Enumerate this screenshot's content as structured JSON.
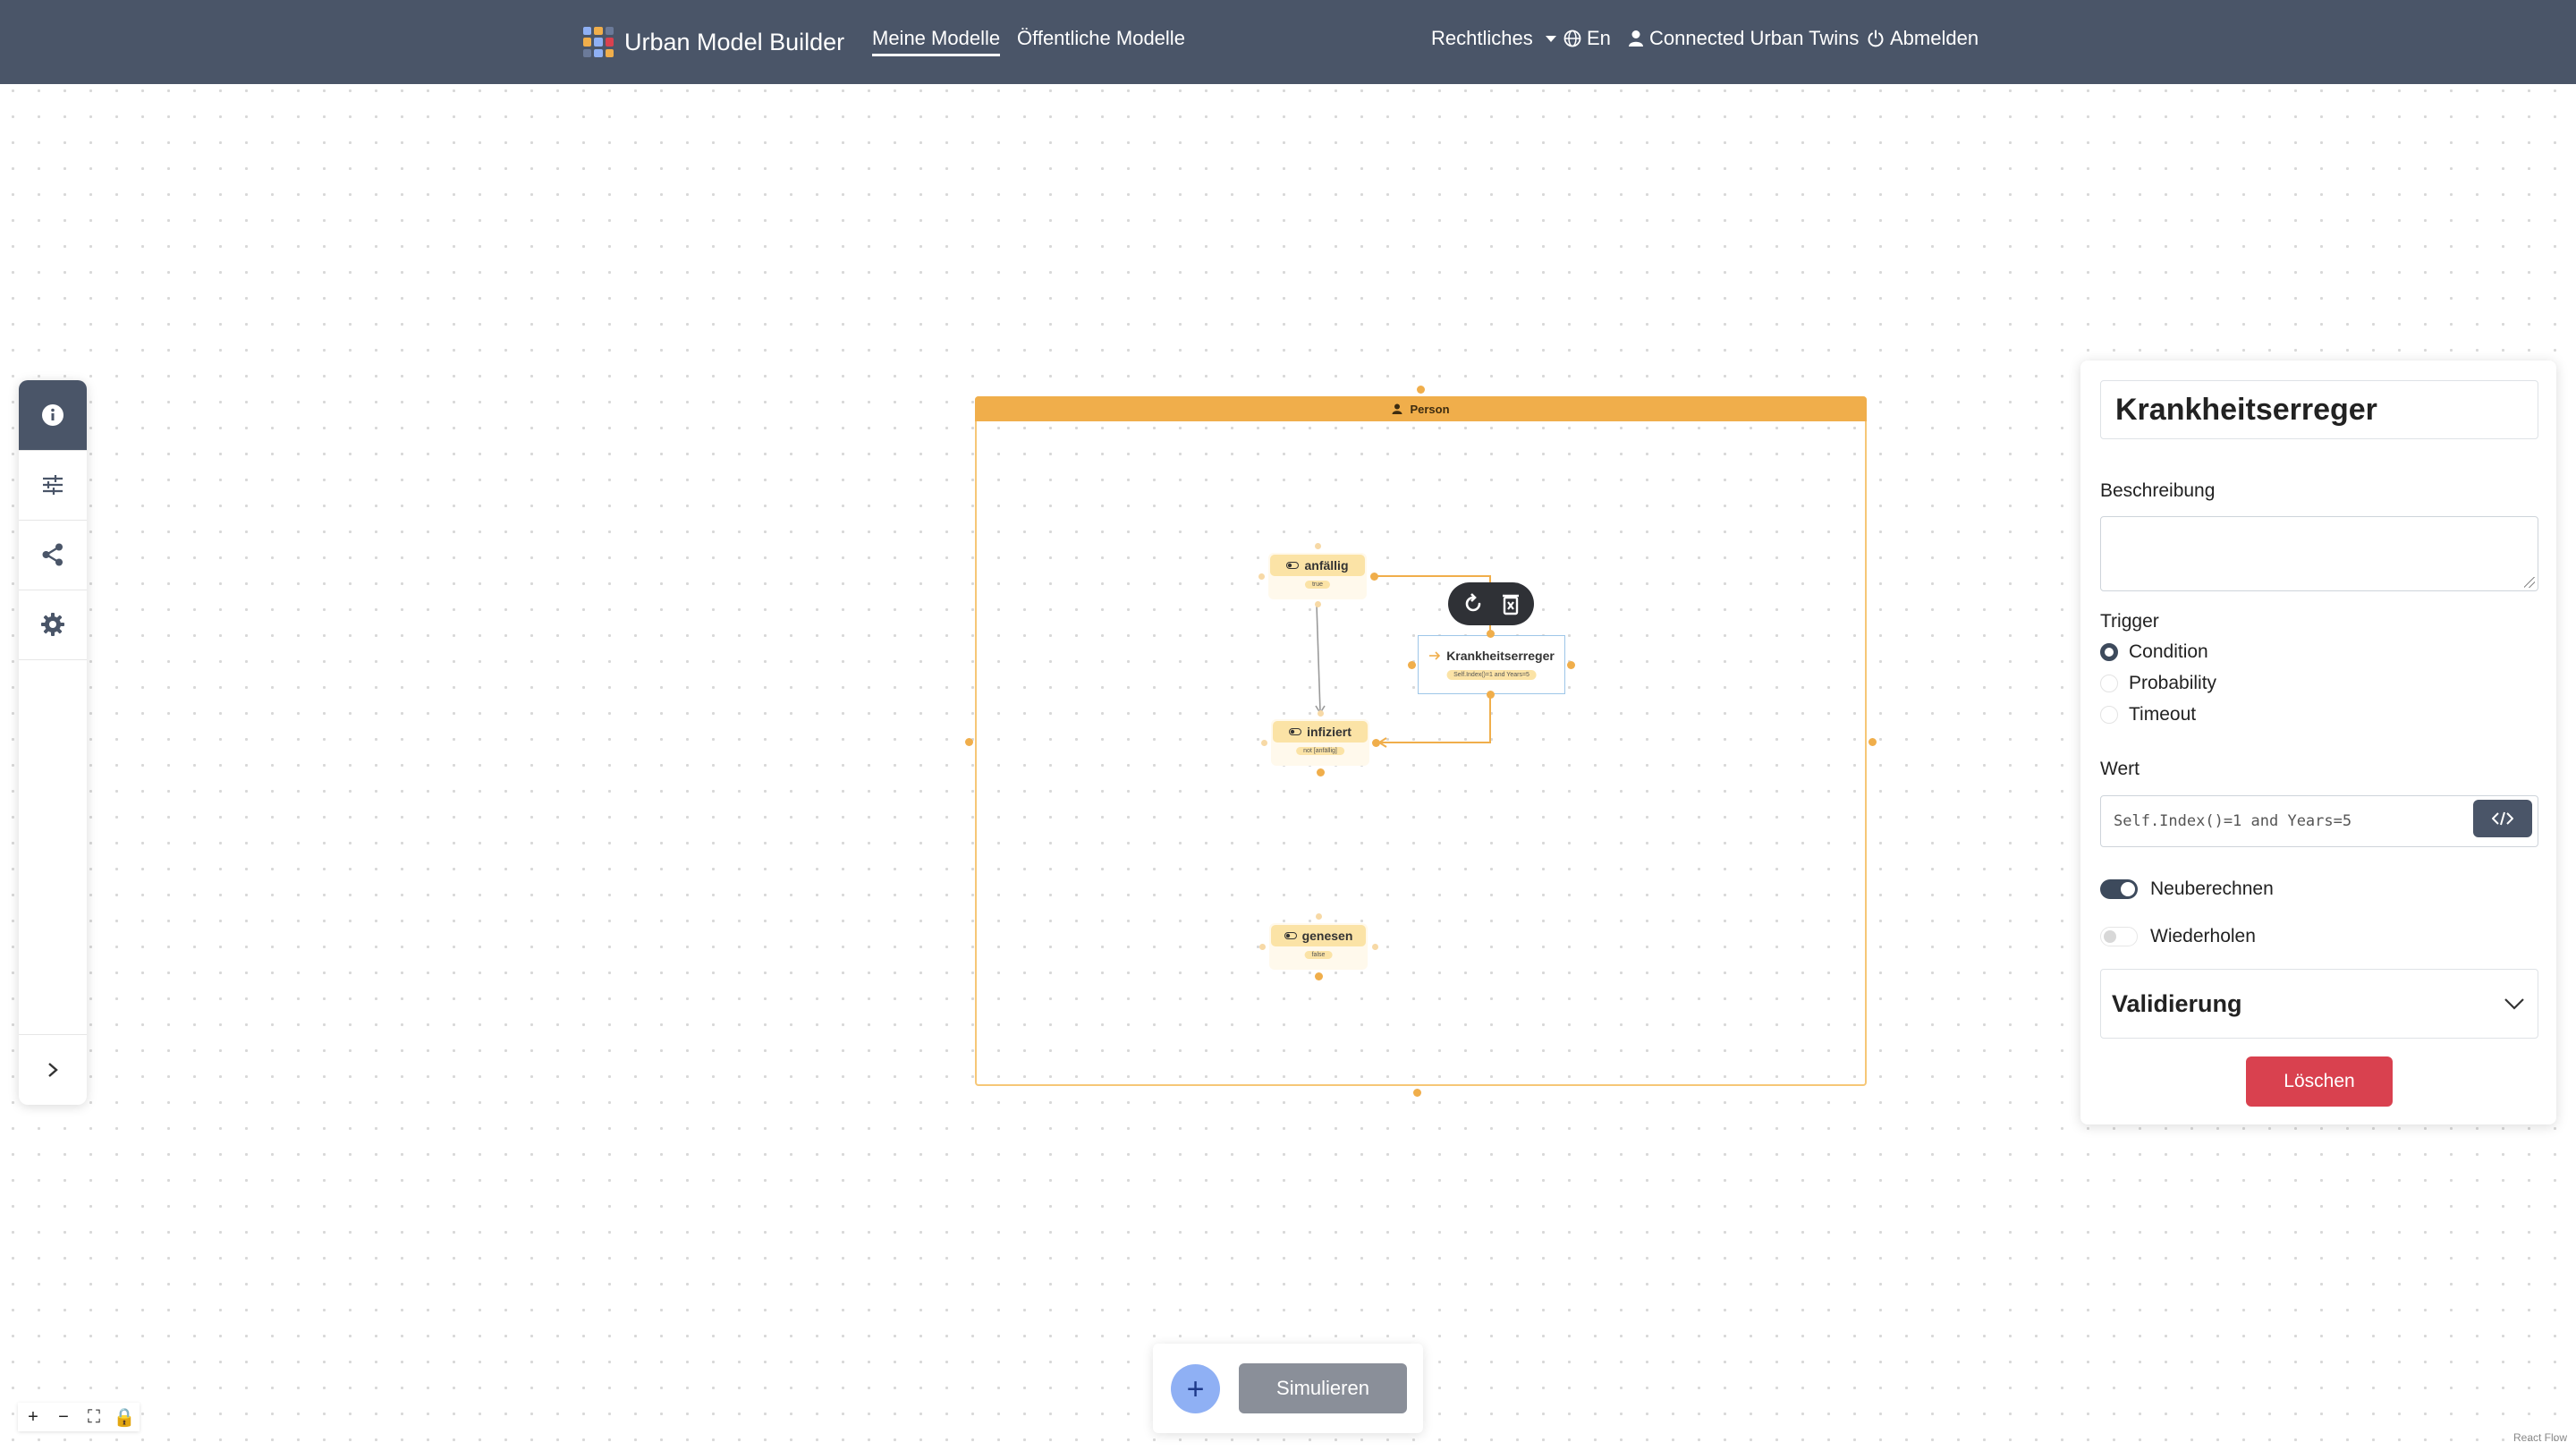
{
  "navbar": {
    "brand": "Urban Model Builder",
    "links": [
      "Meine Modelle",
      "Öffentliche Modelle"
    ],
    "legal": "Rechtliches",
    "language": "En",
    "user": "Connected Urban Twins",
    "logout": "Abmelden"
  },
  "sidebar": {
    "items": [
      {
        "icon": "info-icon",
        "active": true
      },
      {
        "icon": "sliders-icon",
        "active": false
      },
      {
        "icon": "share-icon",
        "active": false
      },
      {
        "icon": "gear-icon",
        "active": false
      }
    ],
    "expand_icon": "chevron-right-icon"
  },
  "canvas": {
    "group_label": "Person",
    "states": [
      {
        "name": "anfällig",
        "value": "true"
      },
      {
        "name": "infiziert",
        "value": "not [anfällig]"
      },
      {
        "name": "genesen",
        "value": "false"
      }
    ],
    "transition": {
      "name": "Krankheitserreger",
      "value": "Self.Index()=1 and Years=5"
    }
  },
  "panel": {
    "title": "Krankheitserreger",
    "description_label": "Beschreibung",
    "trigger_label": "Trigger",
    "trigger_options": [
      "Condition",
      "Probability",
      "Timeout"
    ],
    "trigger_selected": "Condition",
    "value_label": "Wert",
    "value_code": "Self.Index()=1 and Years=5",
    "recalculate_label": "Neuberechnen",
    "recalculate_on": true,
    "repeat_label": "Wiederholen",
    "repeat_on": false,
    "validation_label": "Validierung",
    "delete_label": "Löschen"
  },
  "actions": {
    "add": "+",
    "simulate": "Simulieren"
  },
  "flow_controls": [
    "+",
    "−",
    "⛶",
    "🔒"
  ],
  "attribution": "React Flow",
  "colors": {
    "navbar": "#4a5568",
    "group_accent": "#f0ae4b",
    "state_head": "#fbe3a6",
    "delete": "#d9414f",
    "add_button": "#8fb0f4"
  }
}
